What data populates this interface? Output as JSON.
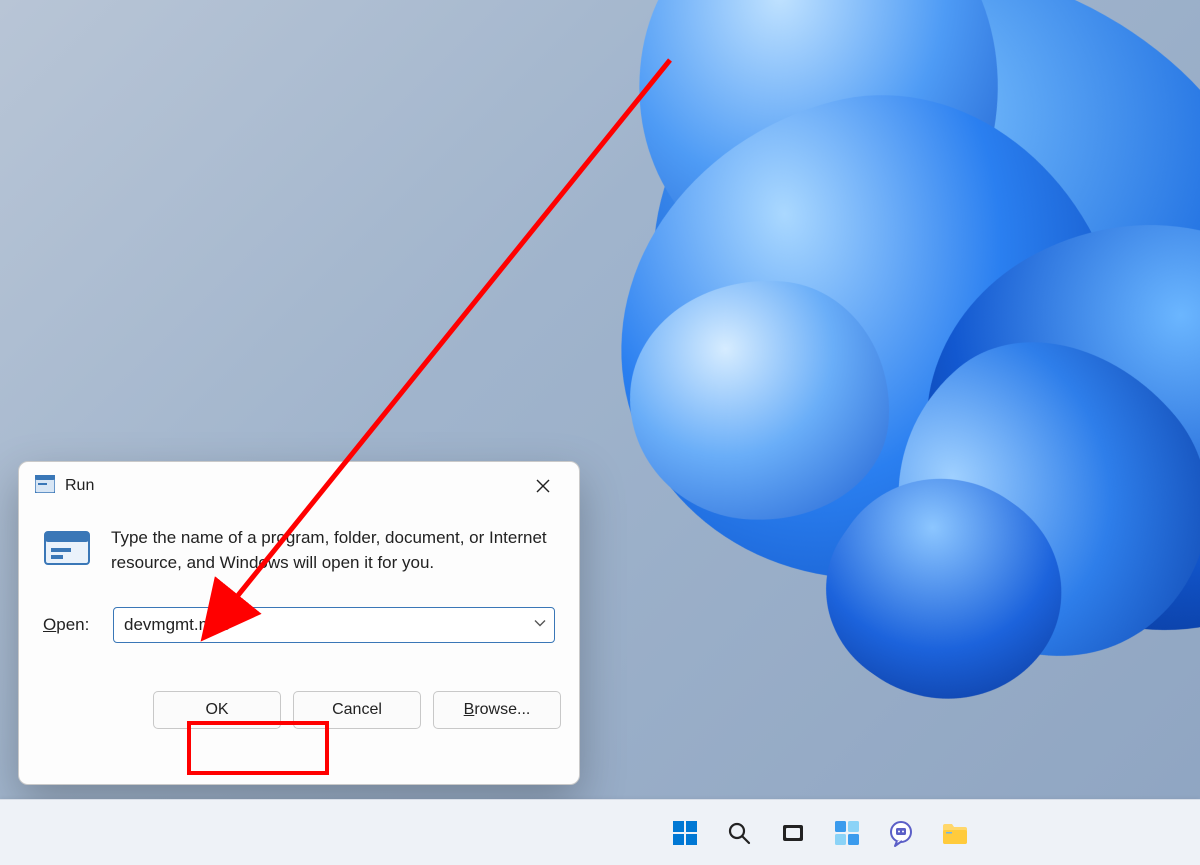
{
  "dialog": {
    "title": "Run",
    "description": "Type the name of a program, folder, document, or Internet resource, and Windows will open it for you.",
    "open_label_underline": "O",
    "open_label_rest": "pen:",
    "input_value": "devmgmt.msc",
    "buttons": {
      "ok": "OK",
      "cancel": "Cancel",
      "browse_underline": "B",
      "browse_rest": "rowse..."
    }
  },
  "taskbar": {
    "items": [
      {
        "name": "start",
        "label": "Start"
      },
      {
        "name": "search",
        "label": "Search"
      },
      {
        "name": "task-view",
        "label": "Task View"
      },
      {
        "name": "widgets",
        "label": "Widgets"
      },
      {
        "name": "chat",
        "label": "Chat"
      },
      {
        "name": "file-explorer",
        "label": "File Explorer"
      }
    ]
  },
  "annotation": {
    "highlight_target": "ok-button",
    "arrow_color": "#ff0000"
  }
}
